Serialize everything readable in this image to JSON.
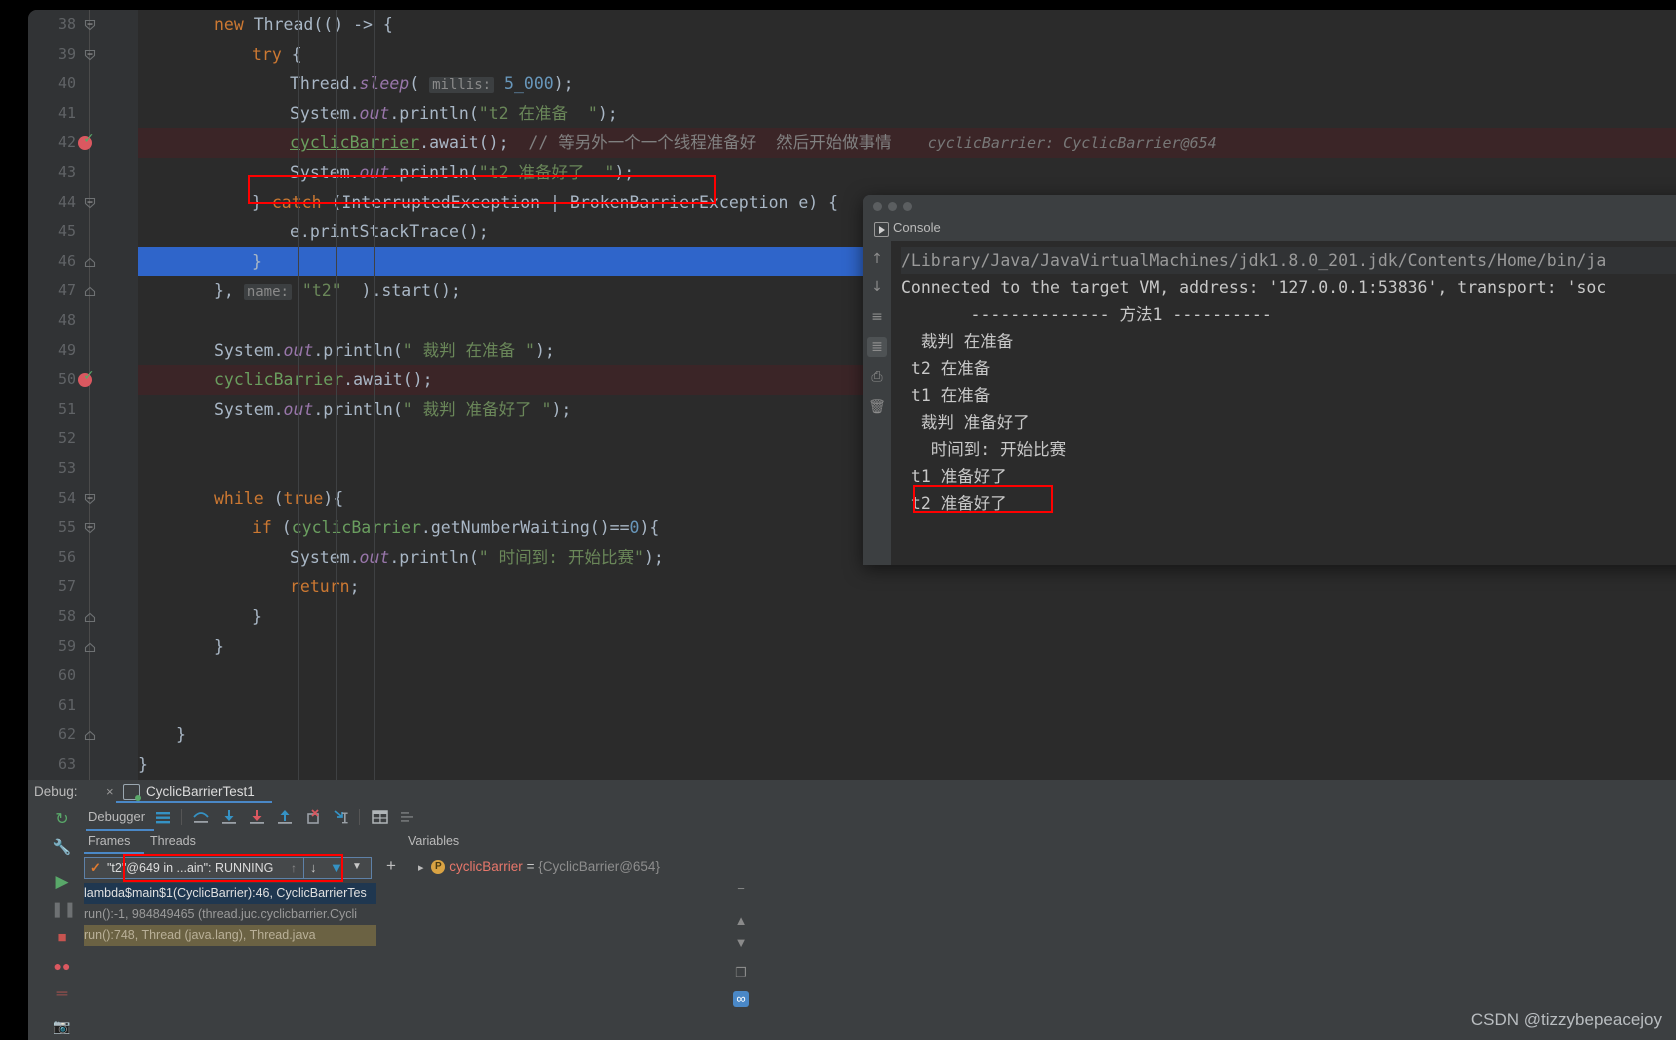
{
  "editor": {
    "lines": [
      {
        "num": 38,
        "indent": 2,
        "fold": "minus",
        "tokens": [
          {
            "t": "new ",
            "c": "k"
          },
          {
            "t": "Thread(() -> {",
            "c": "t"
          }
        ]
      },
      {
        "num": 39,
        "indent": 3,
        "fold": "minus",
        "tokens": [
          {
            "t": "try",
            "c": "k"
          },
          {
            "t": " {",
            "c": "t"
          }
        ]
      },
      {
        "num": 40,
        "indent": 4,
        "tokens": [
          {
            "t": "Thread.",
            "c": "t"
          },
          {
            "t": "sleep",
            "c": "f"
          },
          {
            "t": "( ",
            "c": "t"
          },
          {
            "t": "millis:",
            "c": "hint"
          },
          {
            "t": " ",
            "c": "t"
          },
          {
            "t": "5_000",
            "c": "n"
          },
          {
            "t": ");",
            "c": "t"
          }
        ]
      },
      {
        "num": 41,
        "indent": 4,
        "tokens": [
          {
            "t": "System.",
            "c": "t"
          },
          {
            "t": "out",
            "c": "f"
          },
          {
            "t": ".println(",
            "c": "t"
          },
          {
            "t": "\"t2 在准备  \"",
            "c": "s"
          },
          {
            "t": ");",
            "c": "t"
          }
        ]
      },
      {
        "num": 42,
        "indent": 4,
        "breakpoint": true,
        "bprow": true,
        "tokens": [
          {
            "t": "cyclicBarrier",
            "c": "greenlink"
          },
          {
            "t": ".await();",
            "c": "t"
          },
          {
            "t": "  // 等另外一个一个线程准备好  然后开始做事情",
            "c": "c"
          },
          {
            "t": "    cyclicBarrier: CyclicBarrier@654",
            "c": "inline"
          }
        ]
      },
      {
        "num": 43,
        "indent": 4,
        "tokens": [
          {
            "t": "System.",
            "c": "t"
          },
          {
            "t": "out",
            "c": "f"
          },
          {
            "t": ".println(",
            "c": "t"
          },
          {
            "t": "\"t2 准备好了  \"",
            "c": "s"
          },
          {
            "t": ");",
            "c": "t"
          }
        ]
      },
      {
        "num": 44,
        "indent": 3,
        "fold": "minus",
        "tokens": [
          {
            "t": "} ",
            "c": "t"
          },
          {
            "t": "catch",
            "c": "k"
          },
          {
            "t": " (InterruptedException | BrokenBarrierException e) {",
            "c": "t"
          }
        ]
      },
      {
        "num": 45,
        "indent": 4,
        "tokens": [
          {
            "t": "e.printStackTrace();",
            "c": "t"
          }
        ]
      },
      {
        "num": 46,
        "indent": 3,
        "selected": true,
        "fold": "end",
        "tokens": [
          {
            "t": "}",
            "c": "t"
          }
        ]
      },
      {
        "num": 47,
        "indent": 2,
        "fold": "end",
        "tokens": [
          {
            "t": "}, ",
            "c": "t"
          },
          {
            "t": "name:",
            "c": "hint"
          },
          {
            "t": " ",
            "c": "t"
          },
          {
            "t": "\"t2\"",
            "c": "s"
          },
          {
            "t": "  ).start();",
            "c": "t"
          }
        ]
      },
      {
        "num": 48,
        "indent": 0,
        "tokens": []
      },
      {
        "num": 49,
        "indent": 2,
        "tokens": [
          {
            "t": "System.",
            "c": "t"
          },
          {
            "t": "out",
            "c": "f"
          },
          {
            "t": ".println(",
            "c": "t"
          },
          {
            "t": "\" 裁判 在准备 \"",
            "c": "s"
          },
          {
            "t": ");",
            "c": "t"
          }
        ]
      },
      {
        "num": 50,
        "indent": 2,
        "breakpoint": true,
        "bprow": true,
        "tokens": [
          {
            "t": "cyclicBarrier",
            "c": "green"
          },
          {
            "t": ".await();",
            "c": "t"
          }
        ]
      },
      {
        "num": 51,
        "indent": 2,
        "tokens": [
          {
            "t": "System.",
            "c": "t"
          },
          {
            "t": "out",
            "c": "f"
          },
          {
            "t": ".println(",
            "c": "t"
          },
          {
            "t": "\" 裁判 准备好了 \"",
            "c": "s"
          },
          {
            "t": ");",
            "c": "t"
          }
        ]
      },
      {
        "num": 52,
        "indent": 0,
        "tokens": []
      },
      {
        "num": 53,
        "indent": 0,
        "tokens": []
      },
      {
        "num": 54,
        "indent": 2,
        "fold": "minus",
        "tokens": [
          {
            "t": "while",
            "c": "k"
          },
          {
            "t": " (",
            "c": "t"
          },
          {
            "t": "true",
            "c": "k"
          },
          {
            "t": "){",
            "c": "t"
          }
        ]
      },
      {
        "num": 55,
        "indent": 3,
        "fold": "minus",
        "tokens": [
          {
            "t": "if",
            "c": "k"
          },
          {
            "t": " (",
            "c": "t"
          },
          {
            "t": "cyclicBarrier",
            "c": "green"
          },
          {
            "t": ".getNumberWaiting()==",
            "c": "t"
          },
          {
            "t": "0",
            "c": "n"
          },
          {
            "t": "){",
            "c": "t"
          }
        ]
      },
      {
        "num": 56,
        "indent": 4,
        "tokens": [
          {
            "t": "System.",
            "c": "t"
          },
          {
            "t": "out",
            "c": "f"
          },
          {
            "t": ".println(",
            "c": "t"
          },
          {
            "t": "\" 时间到: 开始比赛\"",
            "c": "s"
          },
          {
            "t": ");",
            "c": "t"
          }
        ]
      },
      {
        "num": 57,
        "indent": 4,
        "tokens": [
          {
            "t": "return",
            "c": "k"
          },
          {
            "t": ";",
            "c": "t"
          }
        ]
      },
      {
        "num": 58,
        "indent": 3,
        "fold": "end",
        "tokens": [
          {
            "t": "}",
            "c": "t"
          }
        ]
      },
      {
        "num": 59,
        "indent": 2,
        "fold": "end",
        "tokens": [
          {
            "t": "}",
            "c": "t"
          }
        ]
      },
      {
        "num": 60,
        "indent": 0,
        "tokens": []
      },
      {
        "num": 61,
        "indent": 0,
        "tokens": []
      },
      {
        "num": 62,
        "indent": 1,
        "fold": "end",
        "tokens": [
          {
            "t": "}",
            "c": "t"
          }
        ]
      },
      {
        "num": 63,
        "indent": 0,
        "tokens": [
          {
            "t": "}",
            "c": "t"
          }
        ]
      }
    ]
  },
  "console": {
    "window_title": "",
    "tab_label": "Console",
    "tool_icons": [
      "scroll-up-icon",
      "scroll-down-icon",
      "soft-wrap-icon",
      "scroll-to-end-icon",
      "print-icon",
      "trash-icon"
    ],
    "lines": [
      {
        "text": "/Library/Java/JavaVirtualMachines/jdk1.8.0_201.jdk/Contents/Home/bin/ja",
        "dim": true
      },
      {
        "text": "Connected to the target VM, address: '127.0.0.1:53836', transport: 'soc",
        "dim": false
      },
      {
        "text": "       -------------- 方法1 ----------",
        "dim": false
      },
      {
        "text": "  裁判 在准备",
        "dim": false
      },
      {
        "text": " t2 在准备",
        "dim": false
      },
      {
        "text": " t1 在准备",
        "dim": false
      },
      {
        "text": "  裁判 准备好了",
        "dim": false
      },
      {
        "text": "   时间到: 开始比赛",
        "dim": false
      },
      {
        "text": " t1 准备好了",
        "dim": false
      },
      {
        "text": " t2 准备好了",
        "dim": false,
        "highlight": true
      }
    ]
  },
  "debug": {
    "header_label": "Debug:",
    "close_icon": "×",
    "tab_name": "CyclicBarrierTest1",
    "left_rail_icons": [
      "rerun-icon",
      "settings-wrench-icon",
      "resume-program-icon",
      "pause-program-icon",
      "stop-icon",
      "view-breakpoints-icon",
      "mute-breakpoints-icon",
      "camera-icon"
    ],
    "toolbar_title": "Debugger",
    "toolbar_icons": [
      "show-execution-point-icon",
      "step-over-icon",
      "step-into-icon",
      "force-step-into-icon",
      "step-out-icon",
      "drop-frame-icon",
      "run-to-cursor-icon",
      "evaluate-expression-icon",
      "settings-icon"
    ],
    "frames_tab": "Frames",
    "threads_tab": "Threads",
    "thread_selector": "\"t2\"@649 in ...ain\": RUNNING",
    "thread_status_icon": "check-icon",
    "frames": [
      {
        "text": "lambda$main$1(CyclicBarrier):46, CyclicBarrierTes",
        "style": "sel"
      },
      {
        "text": "run():-1, 984849465 (thread.juc.cyclicbarrier.Cycli",
        "style": "norm"
      },
      {
        "text": "run():748, Thread (java.lang), Thread.java",
        "style": "lib"
      }
    ],
    "variables_header": "Variables",
    "variables": [
      {
        "name": "cyclicBarrier",
        "eq": " = ",
        "value": "{CyclicBarrier@654}",
        "badge": "P"
      }
    ],
    "add_button": "+"
  },
  "watermark": "CSDN @tizzybepeacejoy",
  "colors": {
    "bg": "#2b2b2b",
    "panel": "#3c3f41",
    "accent": "#4a88c7",
    "selection": "#2f65ca",
    "breakpoint_row": "#3b2527",
    "red_box": "#ff0000"
  }
}
